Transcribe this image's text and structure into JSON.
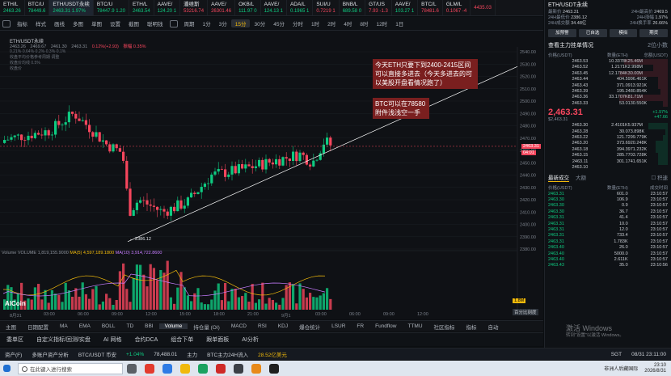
{
  "tickers": [
    {
      "name": "ETH/L",
      "price": "2463.26",
      "change": "",
      "dir": "g"
    },
    {
      "name": "BTC/U",
      "price": "78449.6",
      "change": "",
      "dir": "g"
    },
    {
      "name": "ETH/USDT永续",
      "price": "2463.31",
      "change": "1.97%",
      "dir": "g",
      "active": true
    },
    {
      "name": "BTC/U",
      "price": "78447.9",
      "change": "1.20",
      "dir": "g"
    },
    {
      "name": "ETH/L",
      "price": "2463.54",
      "change": "",
      "dir": "g"
    },
    {
      "name": "AAVE/",
      "price": "124.20",
      "change": "1",
      "dir": "g"
    },
    {
      "name": "潘维斯",
      "price": "53216.74",
      "change": "",
      "dir": "r"
    },
    {
      "name": "AAVE/",
      "price": "26301.46",
      "change": "",
      "dir": "r"
    },
    {
      "name": "OKB/L",
      "price": "111.97",
      "change": "0",
      "dir": "g"
    },
    {
      "name": "AAVE/",
      "price": "124.13",
      "change": "1",
      "dir": "g"
    },
    {
      "name": "ADA/L",
      "price": "0.1965",
      "change": "1",
      "dir": "g"
    },
    {
      "name": "SUI/U",
      "price": "0.7219",
      "change": "1",
      "dir": "r"
    },
    {
      "name": "BNB/L",
      "price": "689.58",
      "change": "0",
      "dir": "g"
    },
    {
      "name": "GT/US",
      "price": "7.93",
      "change": "-1.3",
      "dir": "r"
    },
    {
      "name": "AAVE/",
      "price": "103.27",
      "change": "1",
      "dir": "g"
    },
    {
      "name": "BTC/L",
      "price": "78481.6",
      "change": "",
      "dir": "r"
    },
    {
      "name": "GLM/L",
      "price": "0.1067",
      "change": "-4",
      "dir": "r"
    },
    {
      "name": "",
      "price": "4435.03",
      "change": "",
      "dir": "r"
    }
  ],
  "toolbar": {
    "items": [
      "指标",
      "样式",
      "画线",
      "多图",
      "单图",
      "设置",
      "截图",
      "聪明钱",
      "周期",
      "1分",
      "3分",
      "15分",
      "30分",
      "45分",
      "分时",
      "1时",
      "2时",
      "4时",
      "8时",
      "12时",
      "1日"
    ],
    "selected": "15分"
  },
  "chart": {
    "symbol": "ETH/USDT永续",
    "ohlc": {
      "o": "2463.26",
      "h": "2469.67",
      "l": "2461.30",
      "c": "2463.31",
      "chg": "0.12%(+2.93)",
      "amp": "振幅 0.35%"
    },
    "mini_legend": [
      "0.21%·0.64%·0.2%·0.3%·0.1%",
      "收盘平均价格参考周期 调整",
      "收盘价均线 0.5%",
      "收盘价"
    ],
    "price_ticks": [
      "2540.00",
      "2530.00",
      "2520.00",
      "2510.00",
      "2500.00",
      "2490.00",
      "2480.00",
      "2470.00",
      "2460.00",
      "2450.00",
      "2440.00",
      "2430.00",
      "2420.00",
      "2410.00",
      "2400.00",
      "2390.00",
      "2380.00"
    ],
    "current_price": "2463.31",
    "countdown": "04:01",
    "low_label": "2386.12",
    "note1": "今天ETH只要下到2400-2415区间可以直接多进去（今天多进去的可以美股开盘看情况跑了）",
    "note2": "BTC可以在78580附件浅浅空一手",
    "volume_label": "Volume VOLUME 1,819,155.9000",
    "ma5": "MA(5) 4,597,189.1800",
    "ma10": "MA(10) 3,914,722.8600",
    "vol_tag": "1.8M",
    "logo": "AICoin",
    "time_labels": [
      "8月31",
      "03:00",
      "06:00",
      "09:00",
      "12:00",
      "15:00",
      "18:00",
      "21:00",
      "9月1",
      "03:00",
      "06:00",
      "09:00",
      "12:00"
    ],
    "hundred_btn": "百分比刻度"
  },
  "indicators": {
    "items": [
      "主图",
      "日期配置",
      "MA",
      "EMA",
      "BOLL",
      "TD",
      "BBI",
      "Volume",
      "持仓量 (OI)",
      "MACD",
      "RSI",
      "KDJ",
      "爆仓统计",
      "LSUR",
      "FR",
      "Fundflow",
      "TTMU",
      "社区指标",
      "指标",
      "自动"
    ],
    "selected": "Volume"
  },
  "bottom_tabs": [
    "委单区",
    "自定义指标/回测/实盘",
    "AI 网格",
    "合约DCA",
    "组合下单",
    "跟单面板",
    "AI分析"
  ],
  "status": {
    "assets": "资产(F)",
    "multi": "多账户资产分析",
    "pair": "BTC/USDT 币安",
    "pair_change": "+1.04%",
    "pair_price": "78,488.01",
    "main": "主力",
    "flow": "BTC主力24H流入",
    "flow_val": "28.52亿美元",
    "server": "SGT",
    "datetime": "08/31 23:11:00"
  },
  "taskbar": {
    "search": "在此键入进行搜索",
    "weather": "非洲人后藏国际",
    "time": "23:10",
    "date": "2026/8/31"
  },
  "right_panel": {
    "title": "ETH/USDT永续",
    "stats": [
      {
        "k": "最新价",
        "v": "2463.31"
      },
      {
        "k": "24H最高价",
        "v": "2469.5"
      },
      {
        "k": "24H最低价",
        "v": "2386.12"
      },
      {
        "k": "24H涨幅",
        "v": "1.97%"
      },
      {
        "k": "24H成交额",
        "v": "34.48亿"
      },
      {
        "k": "24H换手率",
        "v": "26.66%"
      }
    ],
    "buttons": [
      "加预警",
      "已自选",
      "模拟",
      "期货"
    ],
    "section": "查看主力挂单情况",
    "section_right": "2位小数",
    "ob_head": [
      "价格(USDT)",
      "数量(ETH)",
      "总额(USDT)"
    ],
    "asks": [
      [
        "2463.53",
        "10.3378K",
        "25.46M",
        0.9
      ],
      [
        "2463.52",
        "1.2171K",
        "2.998M",
        0.3
      ],
      [
        "2463.45",
        "12.1784K",
        "30.00M",
        1.0
      ],
      [
        "2463.44",
        "404.5",
        "996.461K",
        0.2
      ],
      [
        "2463.43",
        "371.0",
        "913.921K",
        0.2
      ],
      [
        "2463.39",
        "195.2",
        "480.854K",
        0.15
      ],
      [
        "2463.36",
        "33.1707K",
        "81.71M",
        1.0
      ],
      [
        "2463.33",
        "53.0",
        "130.550K",
        0.1
      ]
    ],
    "last_price": "2,463.31",
    "last_sub": "$2,463.31",
    "last_change": "+1.97%",
    "last_change2": "+47.66",
    "bids": [
      [
        "2463.30",
        "2.4101K",
        "5.937M",
        0.4
      ],
      [
        "2463.28",
        "30.0",
        "73.898K",
        0.05
      ],
      [
        "2463.22",
        "121.7",
        "299.779K",
        0.1
      ],
      [
        "2463.20",
        "373.6",
        "920.248K",
        0.25
      ],
      [
        "2463.18",
        "394.3",
        "971.232K",
        0.25
      ],
      [
        "2463.15",
        "285.7",
        "703.728K",
        0.2
      ],
      [
        "2463.11",
        "301.1",
        "741.651K",
        0.2
      ],
      [
        "2463.10",
        "",
        "",
        0
      ]
    ],
    "trades_tabs": [
      "最新成交",
      "大额"
    ],
    "trades_check": "积速",
    "trades_head": [
      "价格(USDT)",
      "数量(ETH)",
      "成交时间"
    ],
    "trades": [
      [
        "2463.31",
        "601.0",
        "23:10:57"
      ],
      [
        "2463.30",
        "106.9",
        "23:10:57"
      ],
      [
        "2463.30",
        "0.9",
        "23:10:57"
      ],
      [
        "2463.30",
        "36.7",
        "23:10:57"
      ],
      [
        "2463.31",
        "41.4",
        "23:10:57"
      ],
      [
        "2463.31",
        "10.0",
        "23:10:57"
      ],
      [
        "2463.31",
        "12.0",
        "23:10:57"
      ],
      [
        "2463.31",
        "733.4",
        "23:10:57"
      ],
      [
        "2463.31",
        "1.783K",
        "23:10:57"
      ],
      [
        "2463.40",
        "26.0",
        "23:10:57"
      ],
      [
        "2463.40",
        "5000.0",
        "23:10:57"
      ],
      [
        "2463.40",
        "2.611K",
        "23:10:57"
      ],
      [
        "2463.43",
        "35.0",
        "23:10:56"
      ]
    ]
  },
  "watermark": {
    "line1": "激活 Windows",
    "line2": "转到\"设置\"以激活 Windows。"
  },
  "colors": {
    "up": "#0ecb81",
    "down": "#f6465d",
    "accent": "#f0b90b",
    "note_bg": "#7a1f1f"
  }
}
